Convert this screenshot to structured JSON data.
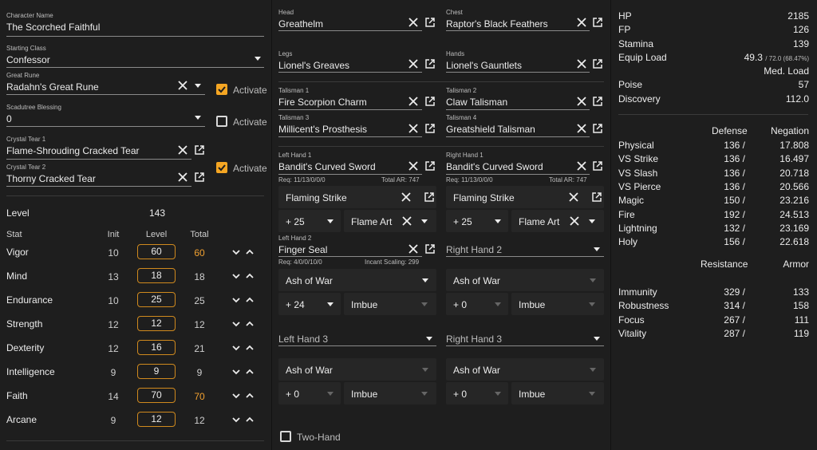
{
  "character": {
    "name_label": "Character Name",
    "name": "The Scorched Faithful",
    "class_label": "Starting Class",
    "class": "Confessor",
    "rune_label": "Great Rune",
    "rune": "Radahn's Great Rune",
    "rune_activate": true,
    "blessing_label": "Scadutree Blessing",
    "blessing": "0",
    "blessing_activate": false,
    "tear1_label": "Crystal Tear 1",
    "tear1": "Flame-Shrouding Cracked Tear",
    "tear2_label": "Crystal Tear 2",
    "tear2": "Thorny Cracked Tear",
    "tear_activate": true,
    "activate_label": "Activate",
    "level_label": "Level",
    "level": "143",
    "stat_headers": {
      "stat": "Stat",
      "init": "Init",
      "level": "Level",
      "total": "Total"
    },
    "stats": [
      {
        "name": "Vigor",
        "init": "10",
        "level": "60",
        "total": "60",
        "highlight": true
      },
      {
        "name": "Mind",
        "init": "13",
        "level": "18",
        "total": "18",
        "highlight": false
      },
      {
        "name": "Endurance",
        "init": "10",
        "level": "25",
        "total": "25",
        "highlight": false
      },
      {
        "name": "Strength",
        "init": "12",
        "level": "12",
        "total": "12",
        "highlight": false
      },
      {
        "name": "Dexterity",
        "init": "12",
        "level": "16",
        "total": "21",
        "highlight": false
      },
      {
        "name": "Intelligence",
        "init": "9",
        "level": "9",
        "total": "9",
        "highlight": false
      },
      {
        "name": "Faith",
        "init": "14",
        "level": "70",
        "total": "70",
        "highlight": true
      },
      {
        "name": "Arcane",
        "init": "9",
        "level": "12",
        "total": "12",
        "highlight": false
      }
    ]
  },
  "equipment": {
    "head_label": "Head",
    "head": "Greathelm",
    "chest_label": "Chest",
    "chest": "Raptor's Black Feathers",
    "legs_label": "Legs",
    "legs": "Lionel's Greaves",
    "hands_label": "Hands",
    "hands": "Lionel's Gauntlets",
    "tal1_label": "Talisman 1",
    "tal1": "Fire Scorpion Charm",
    "tal2_label": "Talisman 2",
    "tal2": "Claw Talisman",
    "tal3_label": "Talisman 3",
    "tal3": "Millicent's Prosthesis",
    "tal4_label": "Talisman 4",
    "tal4": "Greatshield Talisman",
    "lh1_label": "Left Hand 1",
    "lh1": "Bandit's Curved Sword",
    "lh1_req": "Req: 11/13/0/0/0",
    "lh1_ar": "Total AR: 747",
    "lh1_ash": "Flaming Strike",
    "lh1_upg": "+ 25",
    "lh1_aff": "Flame Art",
    "rh1_label": "Right Hand 1",
    "rh1": "Bandit's Curved Sword",
    "rh1_req": "Req: 11/13/0/0/0",
    "rh1_ar": "Total AR: 747",
    "rh1_ash": "Flaming Strike",
    "rh1_upg": "+ 25",
    "rh1_aff": "Flame Art",
    "lh2_label": "Left Hand 2",
    "lh2": "Finger Seal",
    "lh2_req": "Req: 4/0/0/10/0",
    "lh2_scaling": "Incant Scaling: 299",
    "lh2_ash": "Ash of War",
    "lh2_upg": "+ 24",
    "lh2_aff": "Imbue",
    "rh2": "Right Hand 2",
    "rh2_ash": "Ash of War",
    "rh2_upg": "+ 0",
    "rh2_aff": "Imbue",
    "lh3": "Left Hand 3",
    "lh3_ash": "Ash of War",
    "lh3_upg": "+ 0",
    "lh3_aff": "Imbue",
    "rh3": "Right Hand 3",
    "rh3_ash": "Ash of War",
    "rh3_upg": "+ 0",
    "rh3_aff": "Imbue",
    "two_hand_label": "Two-Hand"
  },
  "summary": {
    "hp_label": "HP",
    "hp": "2185",
    "fp_label": "FP",
    "fp": "126",
    "stamina_label": "Stamina",
    "stamina": "139",
    "equip_label": "Equip Load",
    "equip": "49.3",
    "equip_max": "/ 72.0 (68.47%)",
    "equip_class": "Med. Load",
    "poise_label": "Poise",
    "poise": "57",
    "discovery_label": "Discovery",
    "discovery": "112.0",
    "defense_header": "Defense",
    "negation_header": "Negation",
    "defenses": [
      {
        "name": "Physical",
        "def": "136 /",
        "neg": "17.808"
      },
      {
        "name": "VS Strike",
        "def": "136 /",
        "neg": "16.497"
      },
      {
        "name": "VS Slash",
        "def": "136 /",
        "neg": "20.718"
      },
      {
        "name": "VS Pierce",
        "def": "136 /",
        "neg": "20.566"
      },
      {
        "name": "Magic",
        "def": "150 /",
        "neg": "23.216"
      },
      {
        "name": "Fire",
        "def": "192 /",
        "neg": "24.513"
      },
      {
        "name": "Lightning",
        "def": "132 /",
        "neg": "23.169"
      },
      {
        "name": "Holy",
        "def": "156 /",
        "neg": "22.618"
      }
    ],
    "resistance_header": "Resistance",
    "armor_header": "Armor",
    "resistances": [
      {
        "name": "Immunity",
        "res": "329 /",
        "arm": "133"
      },
      {
        "name": "Robustness",
        "res": "314 /",
        "arm": "158"
      },
      {
        "name": "Focus",
        "res": "267 /",
        "arm": "111"
      },
      {
        "name": "Vitality",
        "res": "287 /",
        "arm": "119"
      }
    ]
  },
  "colors": {
    "accent": "#f5a623",
    "panel": "#1e1e1e",
    "background": "#121212"
  }
}
